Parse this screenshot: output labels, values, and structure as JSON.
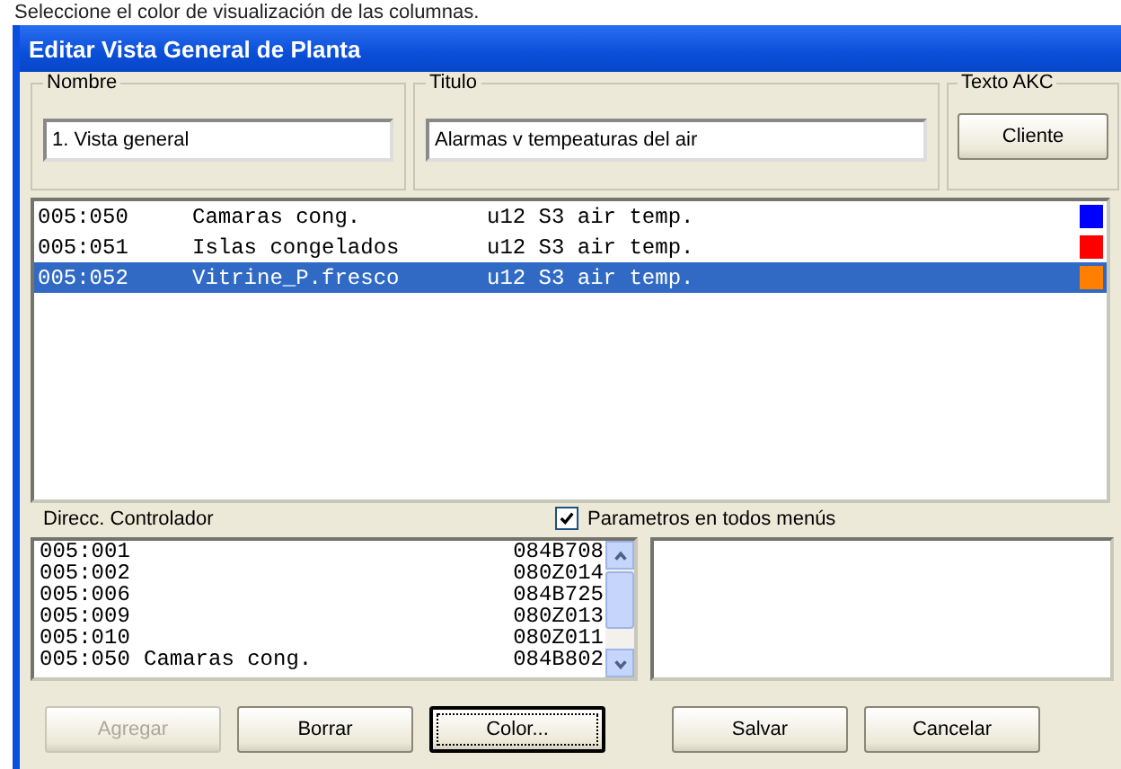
{
  "caption": "Seleccione el color de visualización de las columnas.",
  "window": {
    "title": "Editar Vista General de Planta"
  },
  "nombre": {
    "label": "Nombre",
    "value": "1. Vista general"
  },
  "titulo": {
    "label": "Titulo",
    "value": "Alarmas v tempeaturas del air"
  },
  "texto_akc": {
    "label": "Texto AKC",
    "button": "Cliente"
  },
  "columns": [
    {
      "address": "005:050",
      "name": "Camaras cong.",
      "parameter": "u12 S3 air temp.",
      "color": "#0000ff",
      "selected": false
    },
    {
      "address": "005:051",
      "name": "Islas congelados",
      "parameter": "u12 S3 air temp.",
      "color": "#ff0000",
      "selected": false
    },
    {
      "address": "005:052",
      "name": "Vitrine_P.fresco",
      "parameter": "u12 S3 air temp.",
      "color": "#ff8000",
      "selected": true
    }
  ],
  "controller_label": "Direcc. Controlador",
  "all_menus": {
    "label": "Parametros en todos menús",
    "checked": true
  },
  "controllers": [
    {
      "address": "005:001",
      "code": "084B708"
    },
    {
      "address": "005:002",
      "code": "080Z014"
    },
    {
      "address": "005:006",
      "code": "084B725"
    },
    {
      "address": "005:009",
      "code": "080Z013"
    },
    {
      "address": "005:010",
      "code": "080Z011"
    },
    {
      "address": "005:050",
      "name": "Camaras cong.",
      "code": "084B802"
    }
  ],
  "buttons": [
    {
      "label": "Agregar",
      "disabled": true,
      "focused": false
    },
    {
      "label": "Borrar",
      "disabled": false,
      "focused": false
    },
    {
      "label": "Color...",
      "disabled": false,
      "focused": true
    },
    {
      "label": "Salvar",
      "disabled": false,
      "focused": false
    },
    {
      "label": "Cancelar",
      "disabled": false,
      "focused": false
    }
  ]
}
